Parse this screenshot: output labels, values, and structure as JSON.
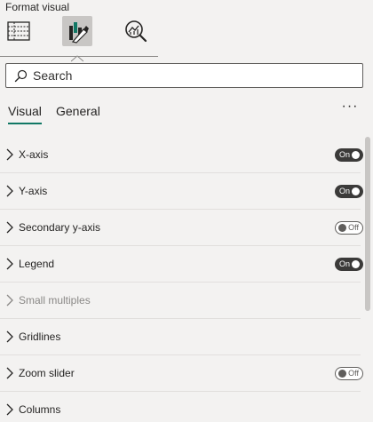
{
  "pane": {
    "title": "Format visual"
  },
  "icon_bar": {
    "buttons": [
      {
        "icon": "build-visual-icon",
        "selected": false
      },
      {
        "icon": "format-visual-icon",
        "selected": true
      },
      {
        "icon": "analytics-icon",
        "selected": false
      }
    ]
  },
  "search": {
    "placeholder": "Search",
    "value": ""
  },
  "tabs": {
    "visual": "Visual",
    "general": "General",
    "active": "Visual",
    "more": "···"
  },
  "sections": [
    {
      "label": "X-axis",
      "toggle": "On",
      "disabled": false
    },
    {
      "label": "Y-axis",
      "toggle": "On",
      "disabled": false
    },
    {
      "label": "Secondary y-axis",
      "toggle": "Off",
      "disabled": false
    },
    {
      "label": "Legend",
      "toggle": "On",
      "disabled": false
    },
    {
      "label": "Small multiples",
      "toggle": null,
      "disabled": true
    },
    {
      "label": "Gridlines",
      "toggle": null,
      "disabled": false
    },
    {
      "label": "Zoom slider",
      "toggle": "Off",
      "disabled": false
    },
    {
      "label": "Columns",
      "toggle": null,
      "disabled": false
    }
  ],
  "colors": {
    "accent": "#117865",
    "toggle_on": "#3b3a39",
    "background": "#f3f2f1"
  }
}
